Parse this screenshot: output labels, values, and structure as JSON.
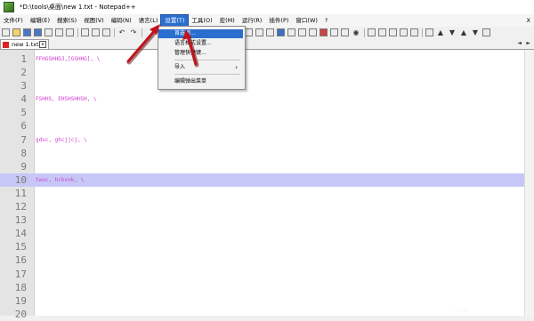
{
  "window": {
    "title": "*D:\\tools\\桌面\\new 1.txt - Notepad++"
  },
  "menu": {
    "items": [
      "文件(F)",
      "编辑(E)",
      "搜索(S)",
      "视图(V)",
      "编码(N)",
      "语言(L)",
      "设置(T)",
      "工具(O)",
      "宏(M)",
      "运行(R)",
      "插件(P)",
      "窗口(W)",
      "?"
    ],
    "active_index": 6,
    "right": "X"
  },
  "tab": {
    "label": "new 1.txt",
    "close": "x"
  },
  "tab_scroll": {
    "left": "◄",
    "right": "►"
  },
  "editor": {
    "current_line": 10,
    "lines": [
      {
        "num": "1",
        "text": "FFHGSHHDJ,[GSHHG], \\"
      },
      {
        "num": "2",
        "text": ""
      },
      {
        "num": "3",
        "text": ""
      },
      {
        "num": "4",
        "text": "FSHHS, EHSHSHHSH, \\"
      },
      {
        "num": "5",
        "text": ""
      },
      {
        "num": "6",
        "text": ""
      },
      {
        "num": "7",
        "text": "gduc, ghcjjcj, \\"
      },
      {
        "num": "8",
        "text": ""
      },
      {
        "num": "9",
        "text": ""
      },
      {
        "num": "10",
        "text": "twuc, hckvvk, \\"
      },
      {
        "num": "11",
        "text": ""
      },
      {
        "num": "12",
        "text": ""
      },
      {
        "num": "13",
        "text": ""
      },
      {
        "num": "14",
        "text": ""
      },
      {
        "num": "15",
        "text": ""
      },
      {
        "num": "16",
        "text": ""
      },
      {
        "num": "17",
        "text": ""
      },
      {
        "num": "18",
        "text": ""
      },
      {
        "num": "19",
        "text": ""
      },
      {
        "num": "20",
        "text": ""
      }
    ]
  },
  "dropdown": {
    "items": [
      "首选项...",
      "语言格式设置...",
      "管理快捷键...",
      "导入",
      "编辑弹出菜单"
    ],
    "highlighted_index": 0,
    "submenu_arrow": "›"
  },
  "status": {
    "dots": "....."
  },
  "colors": {
    "accent": "#2a6fd0",
    "code_text": "#d040d0",
    "current_line": "#c7c7f7",
    "arrow": "#c0141c"
  }
}
